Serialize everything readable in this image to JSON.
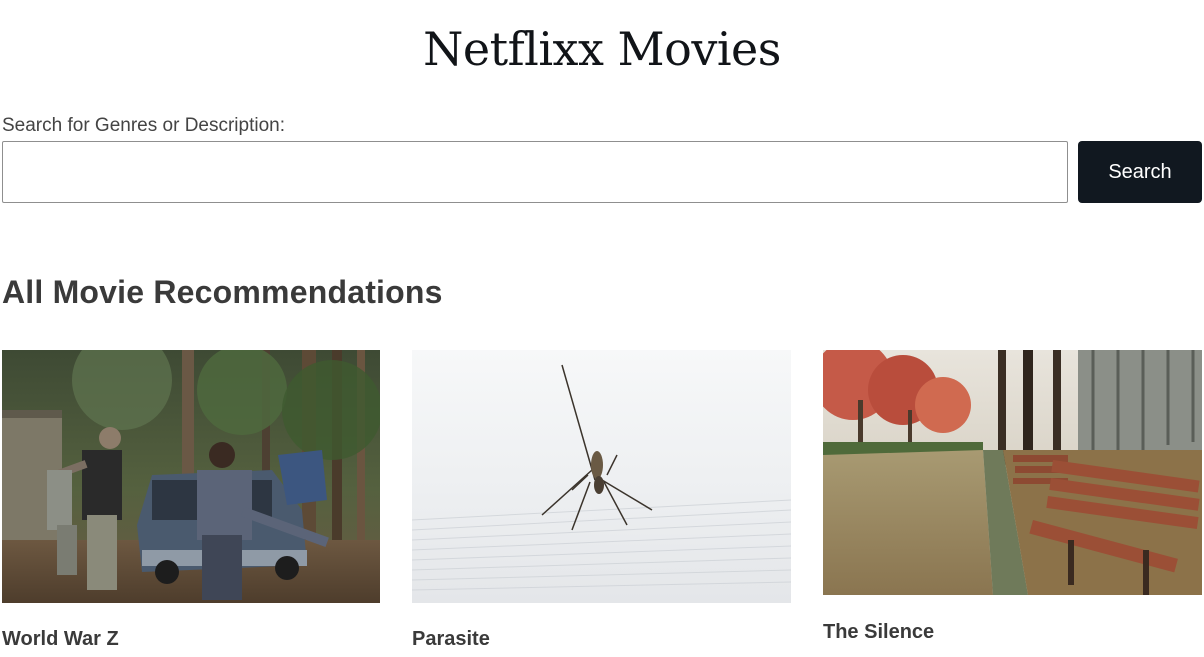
{
  "header": {
    "title": "Netflixx Movies"
  },
  "search": {
    "label": "Search for Genres or Description:",
    "value": "",
    "placeholder": "",
    "button_label": "Search"
  },
  "recommendations": {
    "heading": "All Movie Recommendations",
    "movies": [
      {
        "title": "World War Z",
        "image": "zombies-in-forest-near-car-photo"
      },
      {
        "title": "Parasite",
        "image": "mosquito-on-fabric-photo"
      },
      {
        "title": "The Silence",
        "image": "park-bench-autumn-path-photo"
      }
    ]
  }
}
